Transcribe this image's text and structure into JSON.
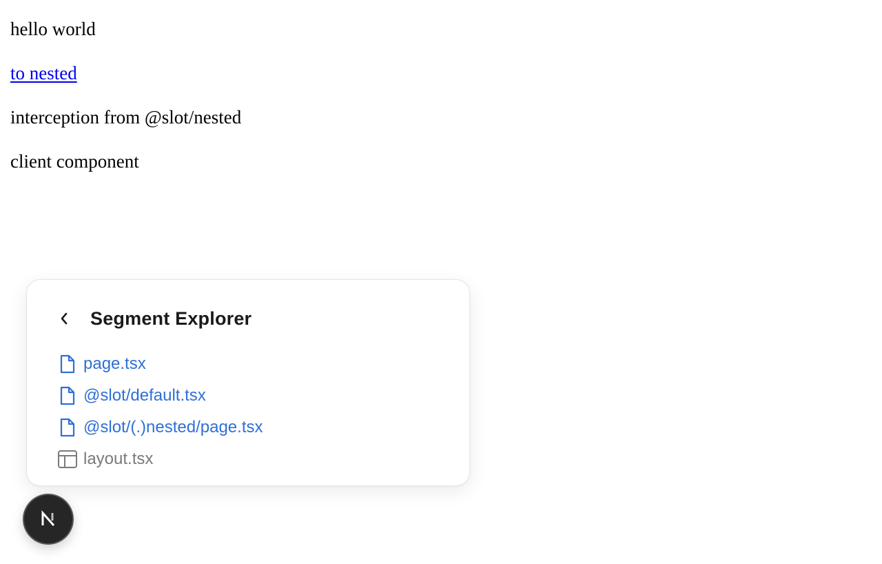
{
  "page": {
    "line1": "hello world",
    "link_label": "to nested",
    "line3": "interception from @slot/nested",
    "line4": "client component"
  },
  "devtools": {
    "panel_title": "Segment Explorer",
    "segments": [
      {
        "label": "page.tsx",
        "type": "file",
        "icon": "file-icon"
      },
      {
        "label": "@slot/default.tsx",
        "type": "file",
        "icon": "file-icon"
      },
      {
        "label": "@slot/(.)nested/page.tsx",
        "type": "file",
        "icon": "file-icon"
      },
      {
        "label": "layout.tsx",
        "type": "layout",
        "icon": "layout-icon"
      }
    ],
    "badge_letter": "N"
  },
  "colors": {
    "link": "#0000ee",
    "segment_file": "#2f6fd6",
    "segment_layout": "#7a7a7a",
    "badge_bg": "#262626"
  }
}
